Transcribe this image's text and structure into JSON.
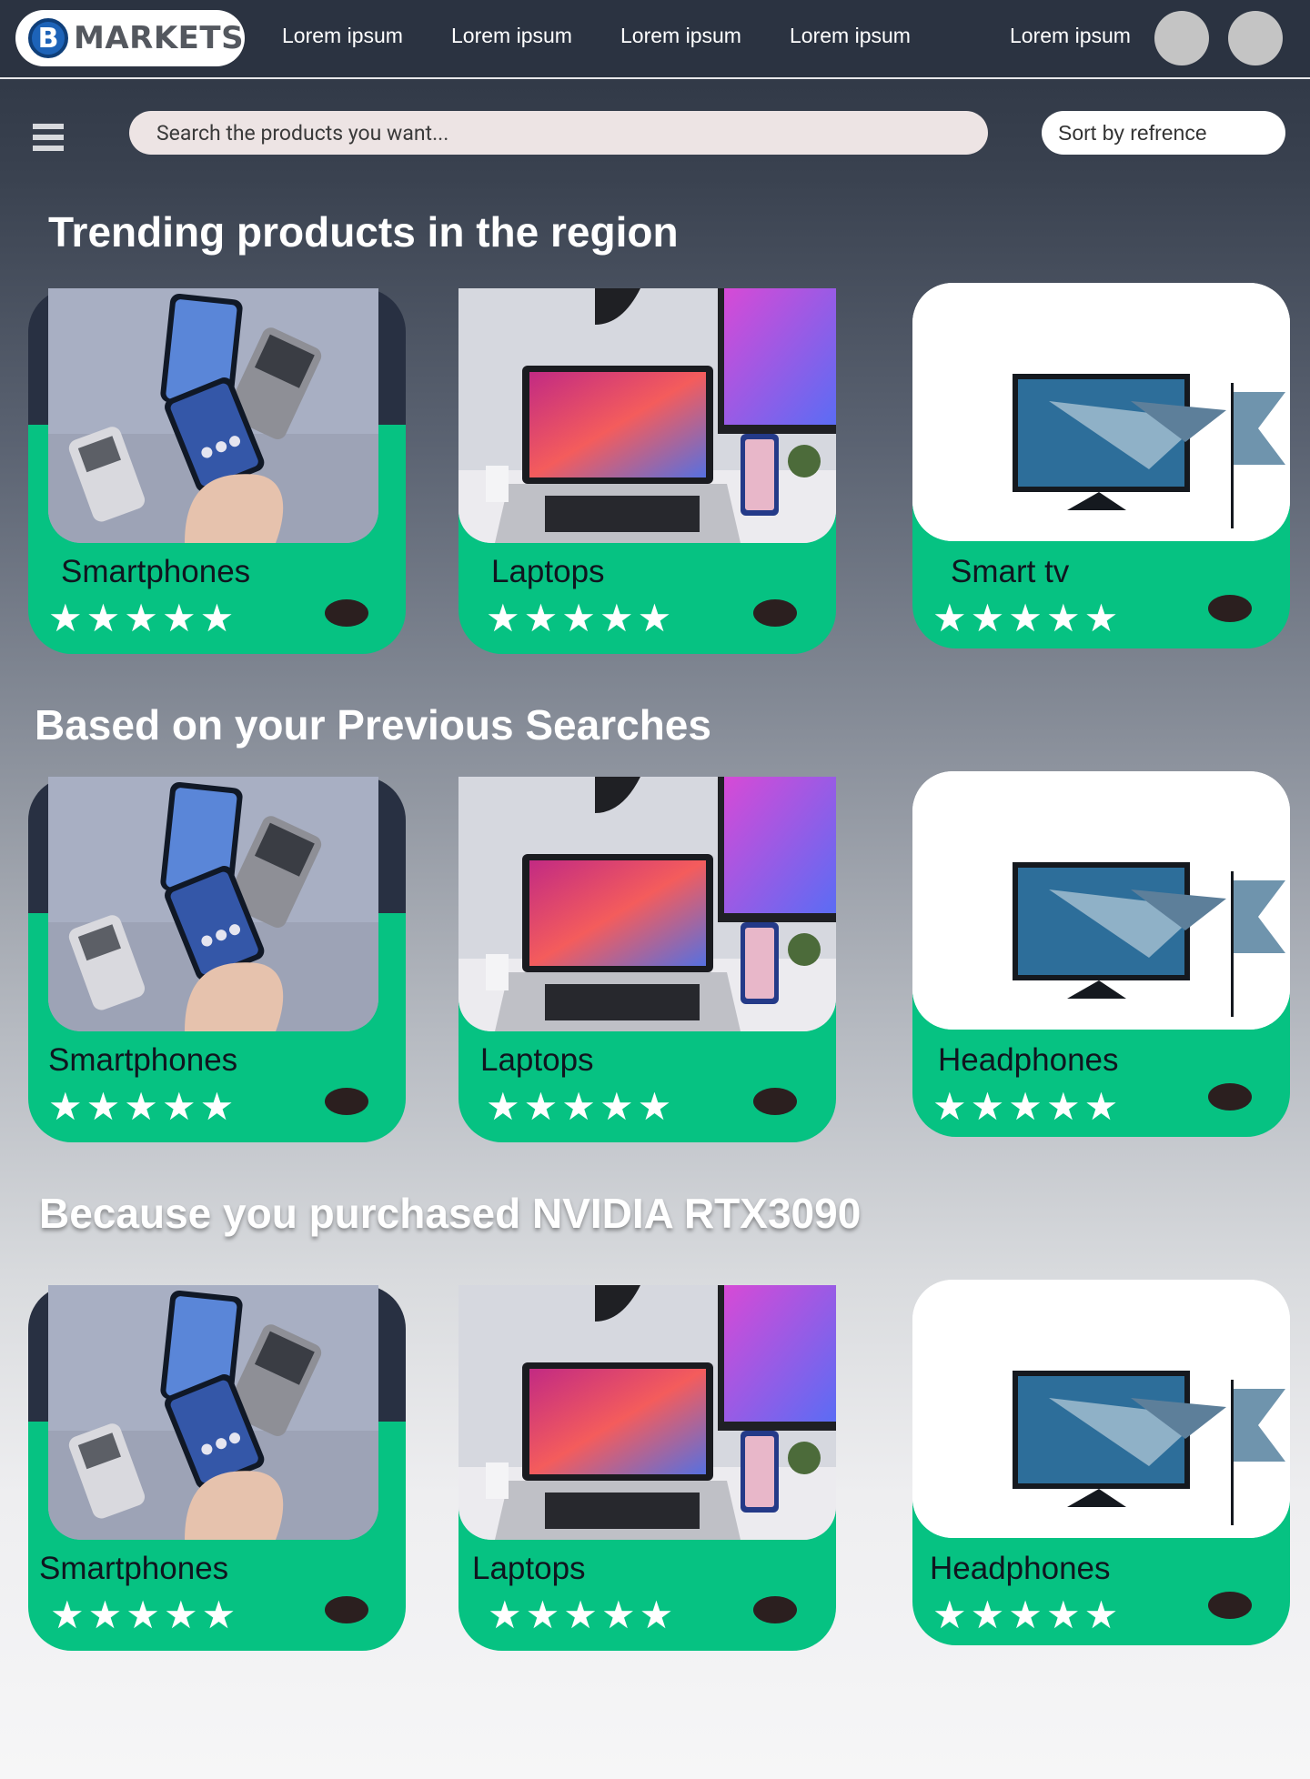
{
  "nav": {
    "logo_letter": "B",
    "logo_text": "MARKETS",
    "links": [
      "Lorem ipsum",
      "Lorem ipsum",
      "Lorem ipsum",
      "Lorem ipsum",
      "Lorem ipsum"
    ]
  },
  "search": {
    "placeholder": "Search the products you want...",
    "sort_label": "Sort by refrence"
  },
  "sections": [
    {
      "title": "Trending products in the region",
      "cards": [
        {
          "name": "Smartphones",
          "rating": 5,
          "image": "smartphone-image"
        },
        {
          "name": "Laptops",
          "rating": 5,
          "image": "laptop-image"
        },
        {
          "name": "Smart tv",
          "rating": 5,
          "image": "smart-tv-image"
        }
      ]
    },
    {
      "title": "Based on your Previous Searches",
      "cards": [
        {
          "name": "Smartphones",
          "rating": 5,
          "image": "smartphone-image"
        },
        {
          "name": "Laptops",
          "rating": 5,
          "image": "laptop-image"
        },
        {
          "name": "Headphones",
          "rating": 5,
          "image": "smart-tv-image"
        }
      ]
    },
    {
      "title": "Because you purchased NVIDIA RTX3090",
      "cards": [
        {
          "name": "Smartphones",
          "rating": 5,
          "image": "smartphone-image"
        },
        {
          "name": "Laptops",
          "rating": 5,
          "image": "laptop-image"
        },
        {
          "name": "Headphones",
          "rating": 5,
          "image": "smart-tv-image"
        }
      ]
    }
  ],
  "stars_text": "★★★★★",
  "colors": {
    "header_bg": "#2b3341",
    "card_green": "#06c282",
    "card_dark": "#283042",
    "fav_dot": "#2b1f1f",
    "logo_blue": "#1d63b8"
  }
}
